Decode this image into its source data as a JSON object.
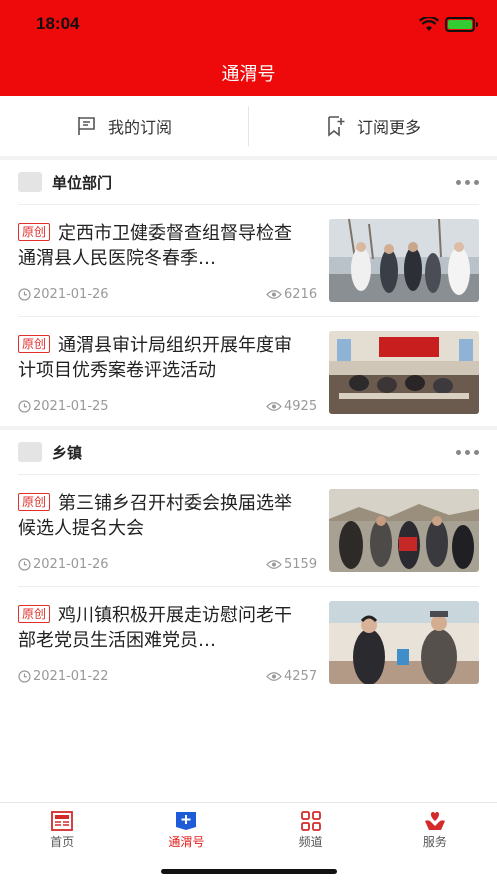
{
  "status": {
    "time": "18:04"
  },
  "header": {
    "title": "通渭号"
  },
  "subbar": {
    "my_subscriptions": "我的订阅",
    "subscribe_more": "订阅更多"
  },
  "sections": [
    {
      "title": "单位部门",
      "items": [
        {
          "tag": "原创",
          "title": "定西市卫健委督查组督导检查通渭县人民医院冬春季…",
          "date": "2021-01-26",
          "views": "6216"
        },
        {
          "tag": "原创",
          "title": "通渭县审计局组织开展年度审计项目优秀案卷评选活动",
          "date": "2021-01-25",
          "views": "4925"
        }
      ]
    },
    {
      "title": "乡镇",
      "items": [
        {
          "tag": "原创",
          "title": "第三铺乡召开村委会换届选举候选人提名大会",
          "date": "2021-01-26",
          "views": "5159"
        },
        {
          "tag": "原创",
          "title": "鸡川镇积极开展走访慰问老干部老党员生活困难党员…",
          "date": "2021-01-22",
          "views": "4257"
        }
      ]
    }
  ],
  "tabbar": {
    "home": "首页",
    "tongweihao": "通渭号",
    "channel": "频道",
    "service": "服务"
  },
  "colors": {
    "brand_red": "#ee0a0a",
    "active_tab": "#e61b1b",
    "tag_red": "#e0302b"
  }
}
